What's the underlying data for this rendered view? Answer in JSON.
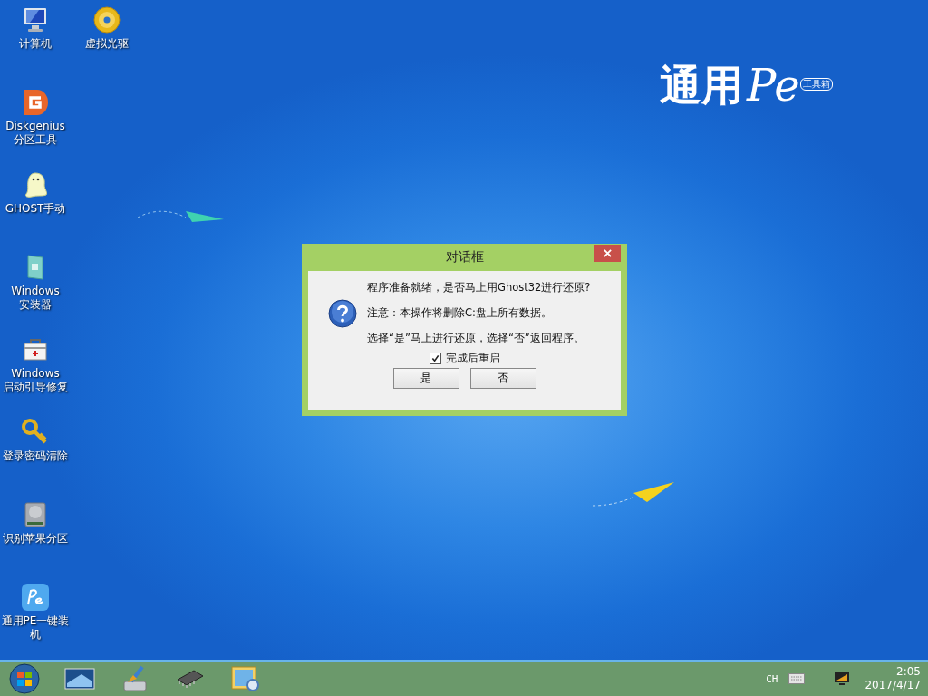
{
  "desktop_icons": [
    {
      "kind": "computer",
      "lines": [
        "计算机"
      ]
    },
    {
      "kind": "disc",
      "lines": [
        "虚拟光驱"
      ]
    },
    {
      "kind": "diskgenius",
      "lines": [
        "Diskgenius",
        "分区工具"
      ]
    },
    {
      "kind": "ghost",
      "lines": [
        "GHOST手动"
      ]
    },
    {
      "kind": "installer",
      "lines": [
        "Windows",
        "安装器"
      ]
    },
    {
      "kind": "toolbox",
      "lines": [
        "Windows",
        "启动引导修复"
      ]
    },
    {
      "kind": "key",
      "lines": [
        "登录密码清除"
      ]
    },
    {
      "kind": "harddisk",
      "lines": [
        "识别苹果分区"
      ]
    },
    {
      "kind": "pe",
      "lines": [
        "通用PE一键装",
        "机"
      ]
    }
  ],
  "logo": {
    "text": "通用",
    "pe": "Pe",
    "badge": "工具箱"
  },
  "dialog": {
    "title": "对话框",
    "lines": [
      "程序准备就绪，是否马上用Ghost32进行还原?",
      "注意：本操作将删除C:盘上所有数据。",
      "选择“是”马上进行还原，选择“否”返回程序。"
    ],
    "checkbox": {
      "label": "完成后重启",
      "checked": true
    },
    "buttons": [
      "是",
      "否"
    ]
  },
  "taskbar": {
    "apps": [
      {
        "kind": "start"
      },
      {
        "kind": "monitor"
      },
      {
        "kind": "brush"
      },
      {
        "kind": "chip"
      },
      {
        "kind": "picture"
      }
    ],
    "language": "CH",
    "time": "2:05",
    "date": "2017/4/17"
  }
}
